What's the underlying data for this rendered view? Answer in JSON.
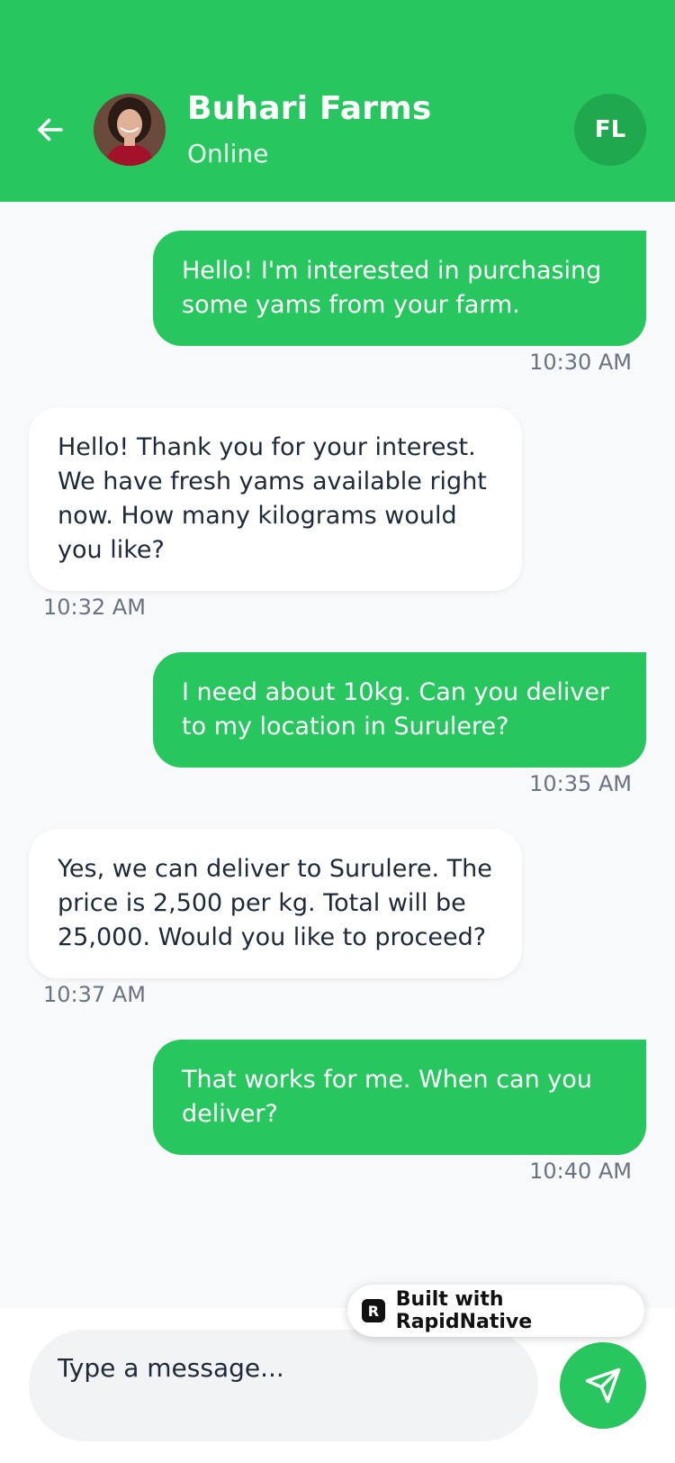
{
  "header": {
    "title": "Buhari Farms",
    "status": "Online",
    "user_initials": "FL"
  },
  "colors": {
    "accent": "#27c65f",
    "badge": "#1fa84e",
    "background": "#f8f9fb"
  },
  "messages": [
    {
      "direction": "out",
      "text": "Hello! I'm interested in purchasing some yams from your farm.",
      "time": "10:30 AM"
    },
    {
      "direction": "in",
      "text": "Hello! Thank you for your interest. We have fresh yams available right now. How many kilograms would you like?",
      "time": "10:32 AM"
    },
    {
      "direction": "out",
      "text": "I need about 10kg. Can you deliver to my location in Surulere?",
      "time": "10:35 AM"
    },
    {
      "direction": "in",
      "text": "Yes, we can deliver to Surulere. The price is   2,500 per kg. Total will be   25,000. Would you like to proceed?",
      "time": "10:37 AM"
    },
    {
      "direction": "out",
      "text": "That works for me. When can you deliver?",
      "time": "10:40 AM"
    }
  ],
  "composer": {
    "placeholder": "Type a message...",
    "send_icon": "send-icon"
  },
  "badge": {
    "label": "Built with RapidNative"
  }
}
